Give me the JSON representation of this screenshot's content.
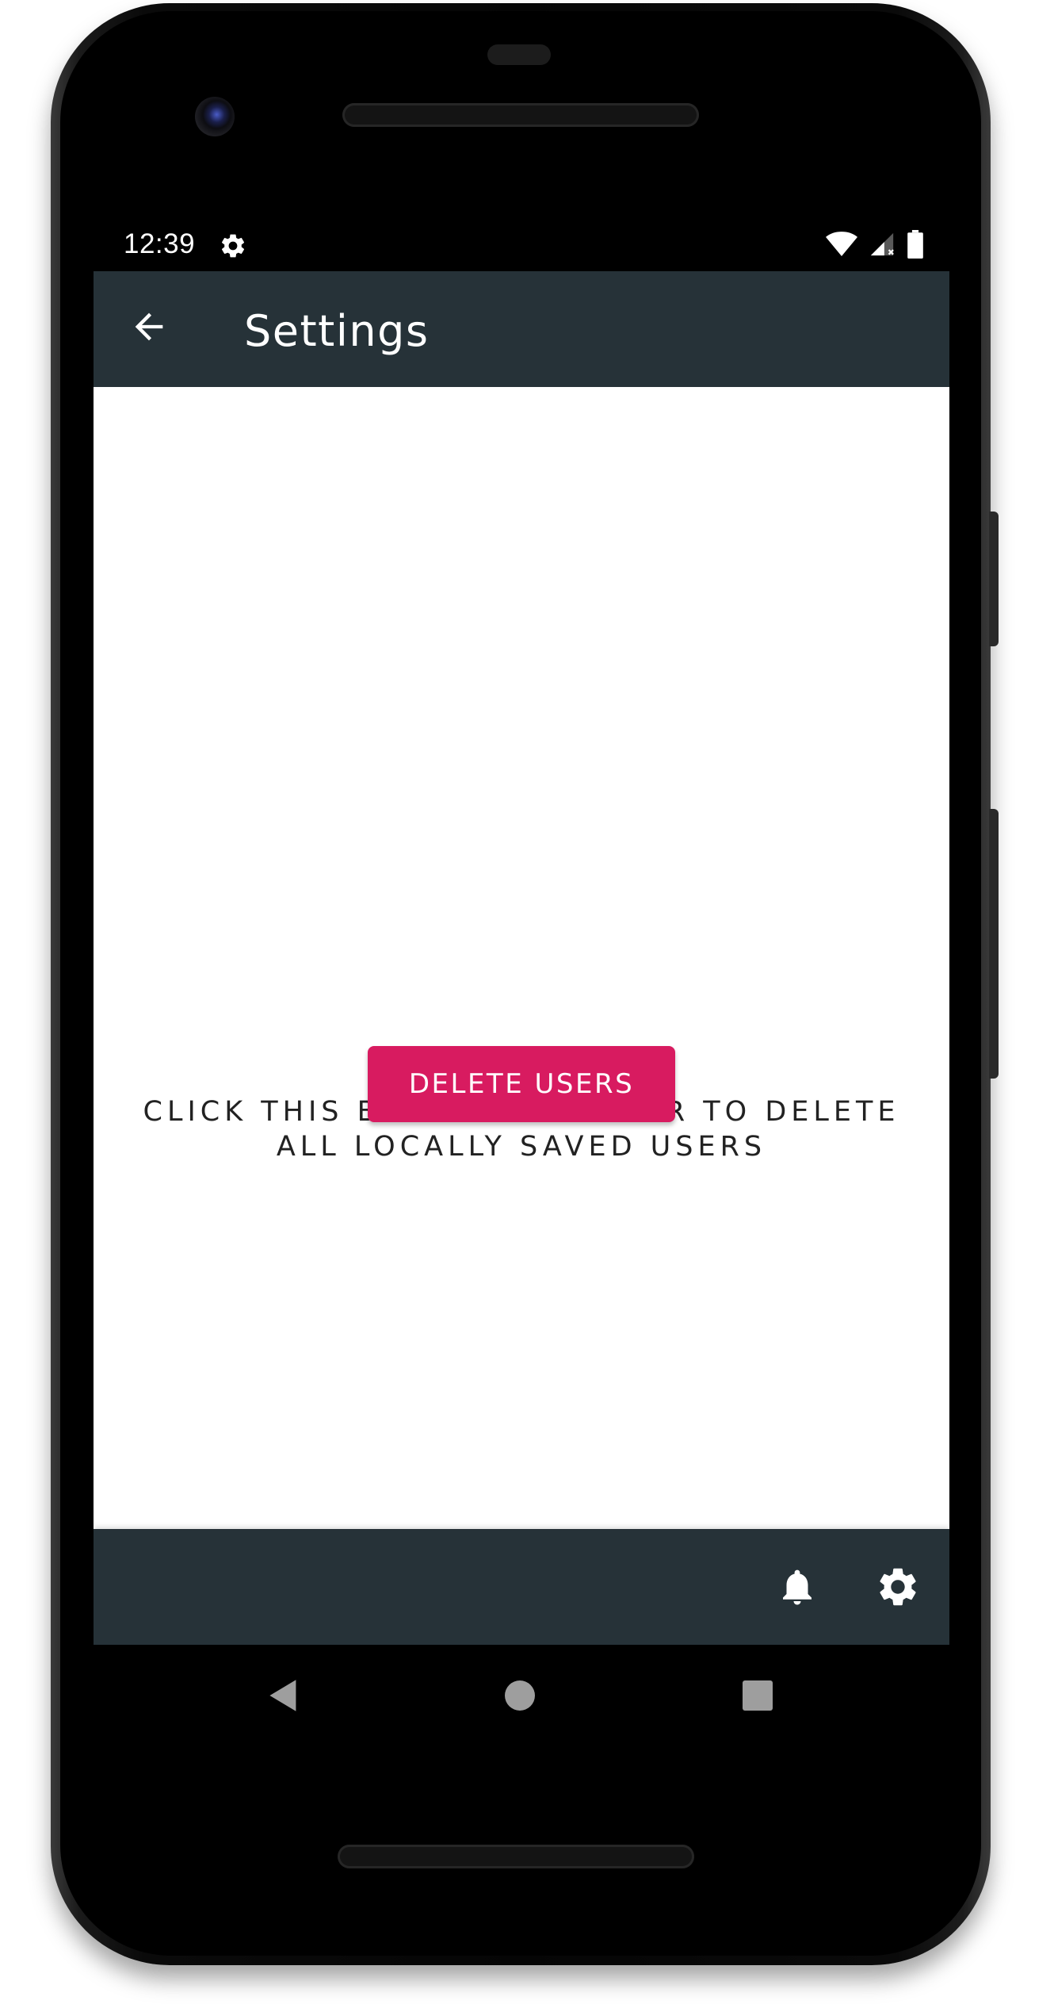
{
  "status_bar": {
    "time": "12:39",
    "icons": [
      "settings-icon",
      "wifi-icon",
      "signal-icon",
      "battery-icon"
    ]
  },
  "app_bar": {
    "title": "Settings",
    "back_icon": "arrow-back-icon"
  },
  "main": {
    "message_line1": "CLICK THIS BUTTON IN ORDER TO DELETE",
    "message_line2": "ALL LOCALLY SAVED USERS",
    "delete_button_label": "DELETE USERS"
  },
  "bottom_bar": {
    "icons": [
      "notifications-icon",
      "settings-icon"
    ]
  },
  "nav_bar": {
    "buttons": [
      "back-triangle-icon",
      "home-circle-icon",
      "recents-square-icon"
    ]
  },
  "colors": {
    "app_bar": "#263238",
    "accent": "#d81b60",
    "background": "#ffffff"
  }
}
